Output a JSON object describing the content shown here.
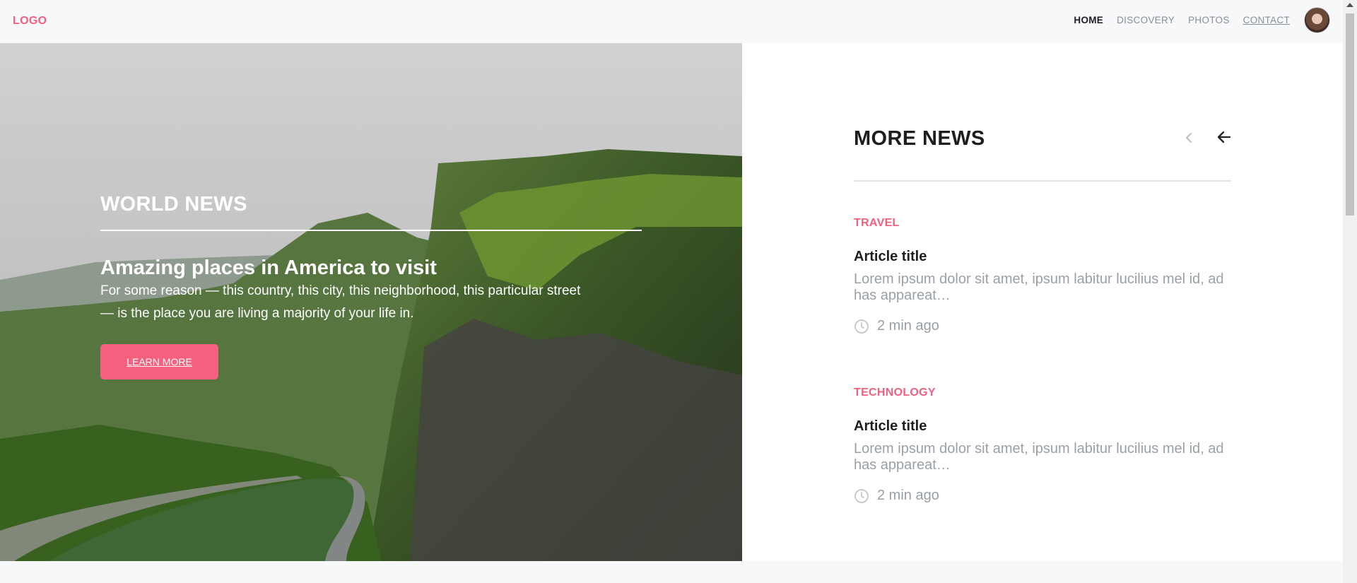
{
  "header": {
    "logo": "LOGO",
    "nav": [
      {
        "label": "HOME"
      },
      {
        "label": "DISCOVERY"
      },
      {
        "label": "PHOTOS"
      },
      {
        "label": "CONTACT"
      }
    ]
  },
  "hero": {
    "section_title": "WORLD NEWS",
    "heading": "Amazing places in America to visit",
    "text": "For some reason — this country, this city, this neighborhood, this particular street — is the place you are living a majority of your life in.",
    "button_label": "LEARN MORE"
  },
  "news": {
    "title": "MORE NEWS",
    "items": [
      {
        "category": "TRAVEL",
        "title": "Article title",
        "excerpt": "Lorem ipsum dolor sit amet, ipsum labitur lucilius mel id, ad has appareat…",
        "time": "2 min ago"
      },
      {
        "category": "TECHNOLOGY",
        "title": "Article title",
        "excerpt": "Lorem ipsum dolor sit amet, ipsum labitur lucilius mel id, ad has appareat…",
        "time": "2 min ago"
      }
    ]
  },
  "icons": {
    "prev": "chevron-left-icon",
    "next": "arrow-left-icon",
    "time": "clock-icon"
  },
  "colors": {
    "accent": "#f5607e",
    "text_dark": "#1e1e1e",
    "text_muted": "#9aa0a8"
  }
}
